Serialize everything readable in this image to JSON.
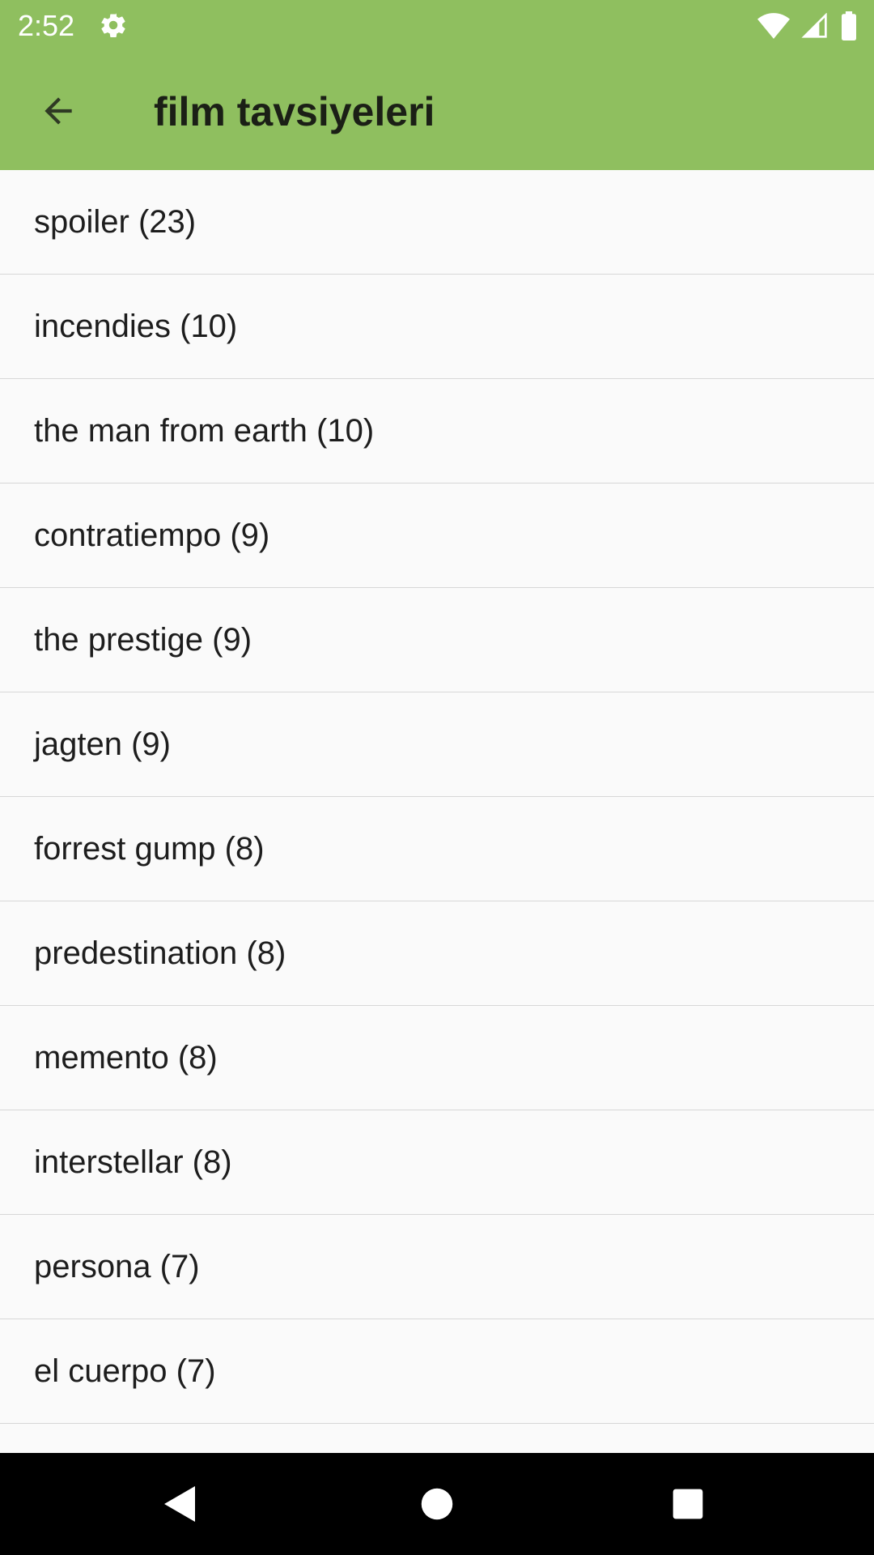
{
  "status_bar": {
    "time": "2:52",
    "icons": [
      "gear-icon",
      "wifi-icon",
      "signal-icon",
      "battery-icon"
    ],
    "color": "#ffffff"
  },
  "app_bar": {
    "title": "film tavsiyeleri",
    "background": "#8fbf5f",
    "back_icon": "arrow-back-icon"
  },
  "list": {
    "items": [
      {
        "label": "spoiler (23)"
      },
      {
        "label": "incendies (10)"
      },
      {
        "label": "the man from earth (10)"
      },
      {
        "label": "contratiempo (9)"
      },
      {
        "label": "the prestige (9)"
      },
      {
        "label": "jagten (9)"
      },
      {
        "label": "forrest gump (8)"
      },
      {
        "label": "predestination (8)"
      },
      {
        "label": "memento (8)"
      },
      {
        "label": "interstellar (8)"
      },
      {
        "label": "persona (7)"
      },
      {
        "label": "el cuerpo (7)"
      }
    ]
  },
  "nav_bar": {
    "icons": [
      "back-triangle-icon",
      "home-circle-icon",
      "recents-square-icon"
    ]
  }
}
